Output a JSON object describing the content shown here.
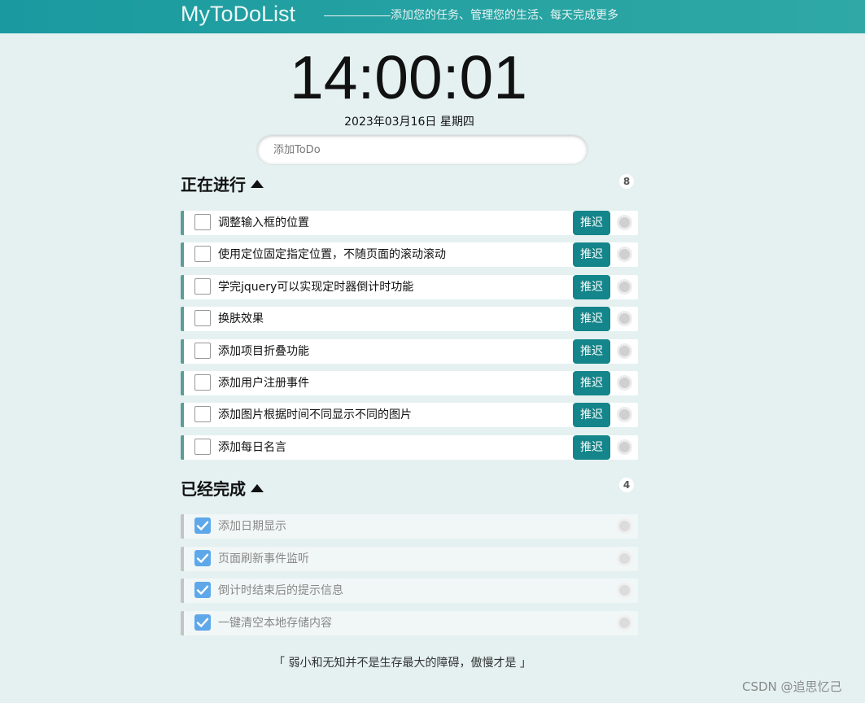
{
  "header": {
    "title": "MyToDoList",
    "slogan": "添加您的任务、管理您的生活、每天完成更多"
  },
  "clock": {
    "time": "14:00:01",
    "date": "2023年03月16日 星期四"
  },
  "add_input": {
    "placeholder": "添加ToDo"
  },
  "in_progress": {
    "title": "正在进行",
    "count": "8",
    "delay_label": "推迟",
    "items": [
      {
        "text": "调整输入框的位置"
      },
      {
        "text": "使用定位固定指定位置，不随页面的滚动滚动"
      },
      {
        "text": "学完jquery可以实现定时器倒计时功能"
      },
      {
        "text": "换肤效果"
      },
      {
        "text": "添加项目折叠功能"
      },
      {
        "text": "添加用户注册事件"
      },
      {
        "text": "添加图片根据时间不同显示不同的图片"
      },
      {
        "text": "添加每日名言"
      }
    ]
  },
  "completed": {
    "title": "已经完成",
    "count": "4",
    "items": [
      {
        "text": "添加日期显示",
        "checked": true
      },
      {
        "text": "页面刷新事件监听",
        "checked": true
      },
      {
        "text": "倒计时结束后的提示信息",
        "checked": true
      },
      {
        "text": "一键清空本地存储内容",
        "checked": true
      }
    ]
  },
  "quote": "「  弱小和无知并不是生存最大的障碍，傲慢才是  」",
  "watermark": "CSDN @追思忆己",
  "colors": {
    "header_bg": "#1a9aa0",
    "page_bg": "#e4f1f0",
    "delay_button": "#14858a",
    "active_border": "#5e9c97",
    "done_check": "#5ea8ea"
  }
}
